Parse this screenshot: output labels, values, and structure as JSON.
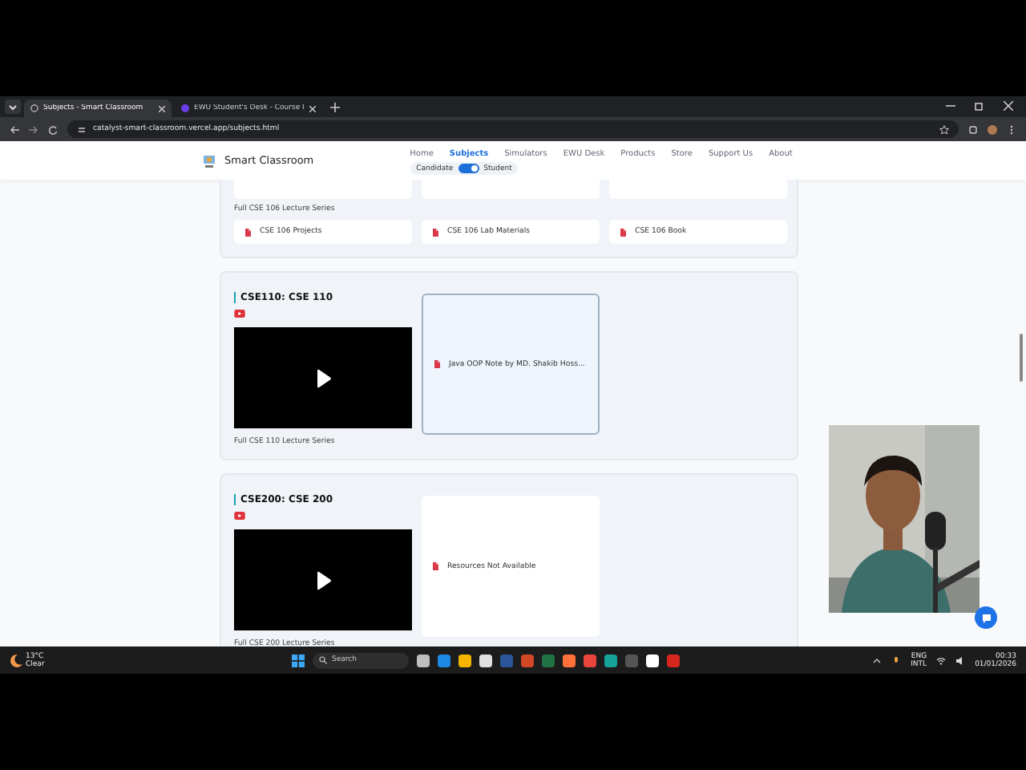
{
  "browser": {
    "tabs": [
      {
        "title": "Subjects - Smart Classroom",
        "selected": true
      },
      {
        "title": "EWU Student's Desk - Course I",
        "selected": false
      }
    ],
    "url": "catalyst-smart-classroom.vercel.app/subjects.html"
  },
  "site": {
    "brand": "Smart Classroom",
    "nav": [
      {
        "label": "Home",
        "selected": false
      },
      {
        "label": "Subjects",
        "selected": true
      },
      {
        "label": "Simulators",
        "selected": false
      },
      {
        "label": "EWU Desk",
        "selected": false
      },
      {
        "label": "Products",
        "selected": false
      },
      {
        "label": "Store",
        "selected": false
      },
      {
        "label": "Support Us",
        "selected": false
      },
      {
        "label": "About",
        "selected": false
      }
    ],
    "mode_toggle": {
      "left": "Candidate",
      "right": "Student",
      "on": true
    }
  },
  "sections": [
    {
      "kind": "tail",
      "caption": "Full CSE 106 Lecture Series",
      "links": [
        "CSE 106 Projects",
        "CSE 106 Lab Materials",
        "CSE 106 Book"
      ]
    },
    {
      "kind": "video",
      "title": "CSE110: CSE 110",
      "caption": "Full CSE 110 Lecture Series",
      "resources": [
        {
          "label": "Java OOP Note by MD. Shakib Hoss...",
          "selected": true
        }
      ]
    },
    {
      "kind": "video",
      "title": "CSE200: CSE 200",
      "caption": "Full CSE 200 Lecture Series",
      "resources": [
        {
          "label": "Resources Not Available",
          "selected": false
        }
      ]
    }
  ],
  "taskbar": {
    "temperature": "13°C",
    "weather": "Clear",
    "search_placeholder": "Search",
    "language": "ENG",
    "layout": "INTL",
    "time": "00:33",
    "date": "01/01/2026"
  }
}
